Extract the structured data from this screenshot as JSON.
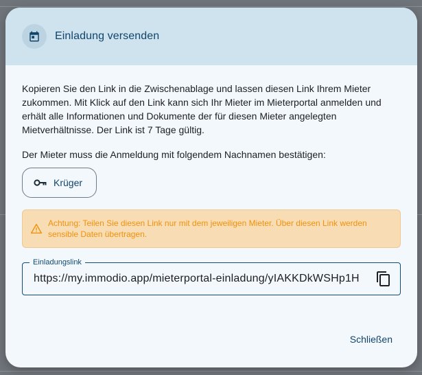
{
  "dialog": {
    "title": "Einladung versenden",
    "header_icon": "calendar-icon",
    "intro": "Kopieren Sie den Link in die Zwischenablage und lassen diesen Link Ihrem Mieter zukommen. Mit Klick auf den Link kann sich Ihr Mieter im Mieterportal anmelden und erhält alle Informationen und Dokumente der für diesen Mieter angelegten Mietverhältnisse. Der Link ist 7 Tage gültig.",
    "confirm_text": "Der Mieter muss die Anmeldung mit folgendem Nachnamen bestätigen:",
    "name_button": {
      "label": "Krüger",
      "icon": "key-icon"
    },
    "alert": {
      "icon": "warning-icon",
      "text": "Achtung: Teilen Sie diesen Link nur mit dem jeweiligen Mieter. Über diesen Link werden sensible Daten übertragen."
    },
    "link_field": {
      "label": "Einladungslink",
      "value": "https://my.immodio.app/mieterportal-einladung/yIAKKDkWSHp1H",
      "copy_icon": "copy-icon"
    },
    "close_label": "Schließen"
  },
  "colors": {
    "primary": "#10446b",
    "header_bg": "#cfe3ee",
    "dialog_bg": "#f3f8fc",
    "alert_bg": "#f8dcb3",
    "alert_text": "#f0920c"
  }
}
